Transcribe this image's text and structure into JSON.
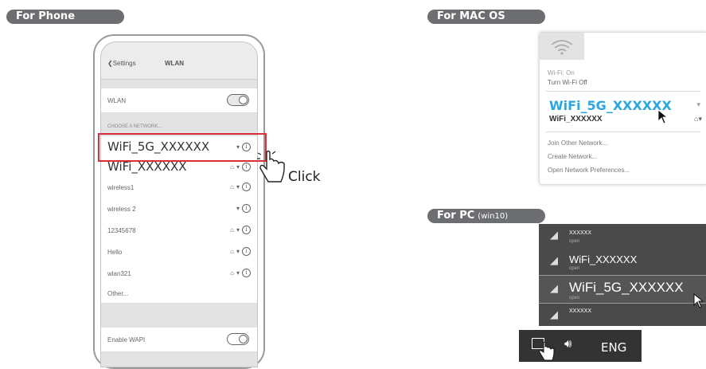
{
  "labels": {
    "phone": "For Phone",
    "mac": "For MAC OS",
    "pc": "For PC",
    "pc_sub": "(win10)",
    "click": "Click"
  },
  "phone": {
    "back": "Settings",
    "title": "WLAN",
    "wlan": "WLAN",
    "section": "CHOOSE A NETWORK...",
    "networks": [
      {
        "name": "WiFi_5G_XXXXXX"
      },
      {
        "name": "WiFi_XXXXXX"
      },
      {
        "name": "wireless1"
      },
      {
        "name": "wireless 2"
      },
      {
        "name": "12345678"
      },
      {
        "name": "Hello"
      },
      {
        "name": "wlan321"
      }
    ],
    "other": "Other...",
    "wapi": "Enable WAPI"
  },
  "mac": {
    "wifi_on": "Wi-Fi: On",
    "turn_off": "Turn Wi-Fi Off",
    "net_primary": "WiFi_5G_XXXXXX",
    "net_secondary": "WiFi_XXXXXX",
    "join_other": "Join Other Network...",
    "create": "Create Network...",
    "prefs": "Open Network Preferences..."
  },
  "pc": {
    "rows": [
      {
        "name": "XXXXXX",
        "status": "open"
      },
      {
        "name": "WiFi_XXXXXX",
        "status": "open"
      },
      {
        "name": "WiFi_5G_XXXXXX",
        "status": "open"
      },
      {
        "name": "XXXXXX",
        "status": ""
      }
    ],
    "lang": "ENG"
  }
}
